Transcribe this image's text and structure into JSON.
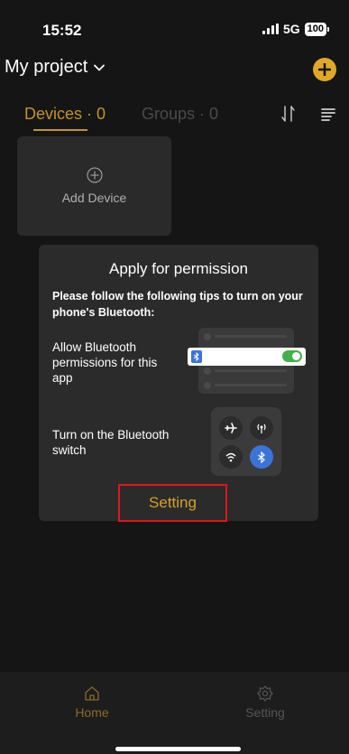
{
  "status_bar": {
    "time": "15:52",
    "network": "5G",
    "battery": "100"
  },
  "header": {
    "project_title": "My project"
  },
  "tabs": [
    {
      "label": "Devices · 0"
    },
    {
      "label": "Groups · 0"
    }
  ],
  "add_device": {
    "label": "Add Device"
  },
  "dialog": {
    "title": "Apply for permission",
    "subtitle": "Please follow the following tips to turn on your phone's Bluetooth:",
    "tip1": "Allow Bluetooth permissions for this app",
    "tip2": "Turn on the Bluetooth switch",
    "setting_button": "Setting"
  },
  "bottom_nav": [
    {
      "label": "Home",
      "icon": "home-icon"
    },
    {
      "label": "Setting",
      "icon": "gear-icon"
    }
  ],
  "colors": {
    "accent": "#d7a02a",
    "bluetooth": "#3a74d8",
    "toggle_on": "#43b149",
    "highlight_box": "#e0141e"
  }
}
